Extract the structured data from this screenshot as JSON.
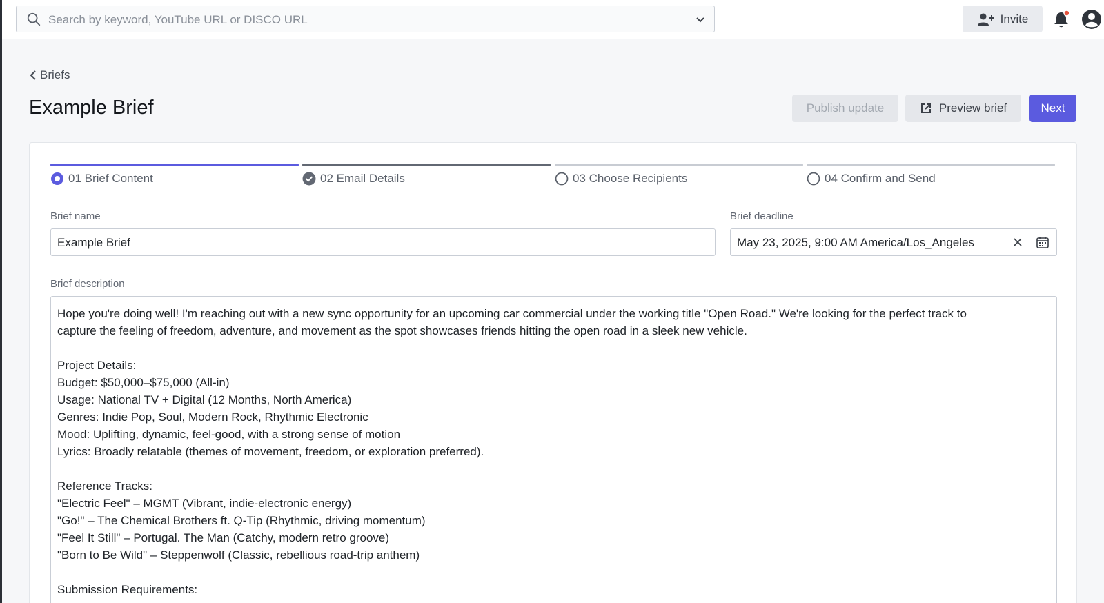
{
  "search": {
    "placeholder": "Search by keyword, YouTube URL or DISCO URL"
  },
  "topbar": {
    "invite_label": "Invite"
  },
  "breadcrumb": {
    "label": "Briefs"
  },
  "page": {
    "title": "Example Brief"
  },
  "actions": {
    "publish_label": "Publish update",
    "preview_label": "Preview brief",
    "next_label": "Next"
  },
  "steps": [
    {
      "label": "01 Brief Content",
      "state": "current"
    },
    {
      "label": "02 Email Details",
      "state": "complete"
    },
    {
      "label": "03 Choose Recipients",
      "state": "pending"
    },
    {
      "label": "04 Confirm and Send",
      "state": "pending"
    }
  ],
  "form": {
    "name_label": "Brief name",
    "name_value": "Example Brief",
    "deadline_label": "Brief deadline",
    "deadline_value": "May 23, 2025, 9:00 AM America/Los_Angeles",
    "description_label": "Brief description",
    "description_lines": [
      "Hope you're doing well! I'm reaching out with a new sync opportunity for an upcoming car commercial under the working title \"Open Road.\" We're looking for the perfect track to",
      "capture the feeling of freedom, adventure, and movement as the spot showcases friends hitting the open road in a sleek new vehicle.",
      "",
      "Project Details:",
      "Budget: $50,000–$75,000 (All-in)",
      "Usage: National TV + Digital (12 Months, North America)",
      "Genres: Indie Pop, Soul, Modern Rock, Rhythmic Electronic",
      "Mood: Uplifting, dynamic, feel-good, with a strong sense of motion",
      "Lyrics: Broadly relatable (themes of movement, freedom, or exploration preferred).",
      "",
      "Reference Tracks:",
      "\"Electric Feel\" – MGMT (Vibrant, indie-electronic energy)",
      "\"Go!\" – The Chemical Brothers ft. Q-Tip (Rhythmic, driving momentum)",
      "\"Feel It Still\" – Portugal. The Man (Catchy, modern retro groove)",
      "\"Born to Be Wild\" – Steppenwolf (Classic, rebellious road-trip anthem)",
      "",
      "Submission Requirements:"
    ]
  },
  "colors": {
    "accent": "#5b5bdf",
    "complete": "#626873",
    "pending": "#c8ccd3",
    "notification_dot": "#e5533d"
  }
}
